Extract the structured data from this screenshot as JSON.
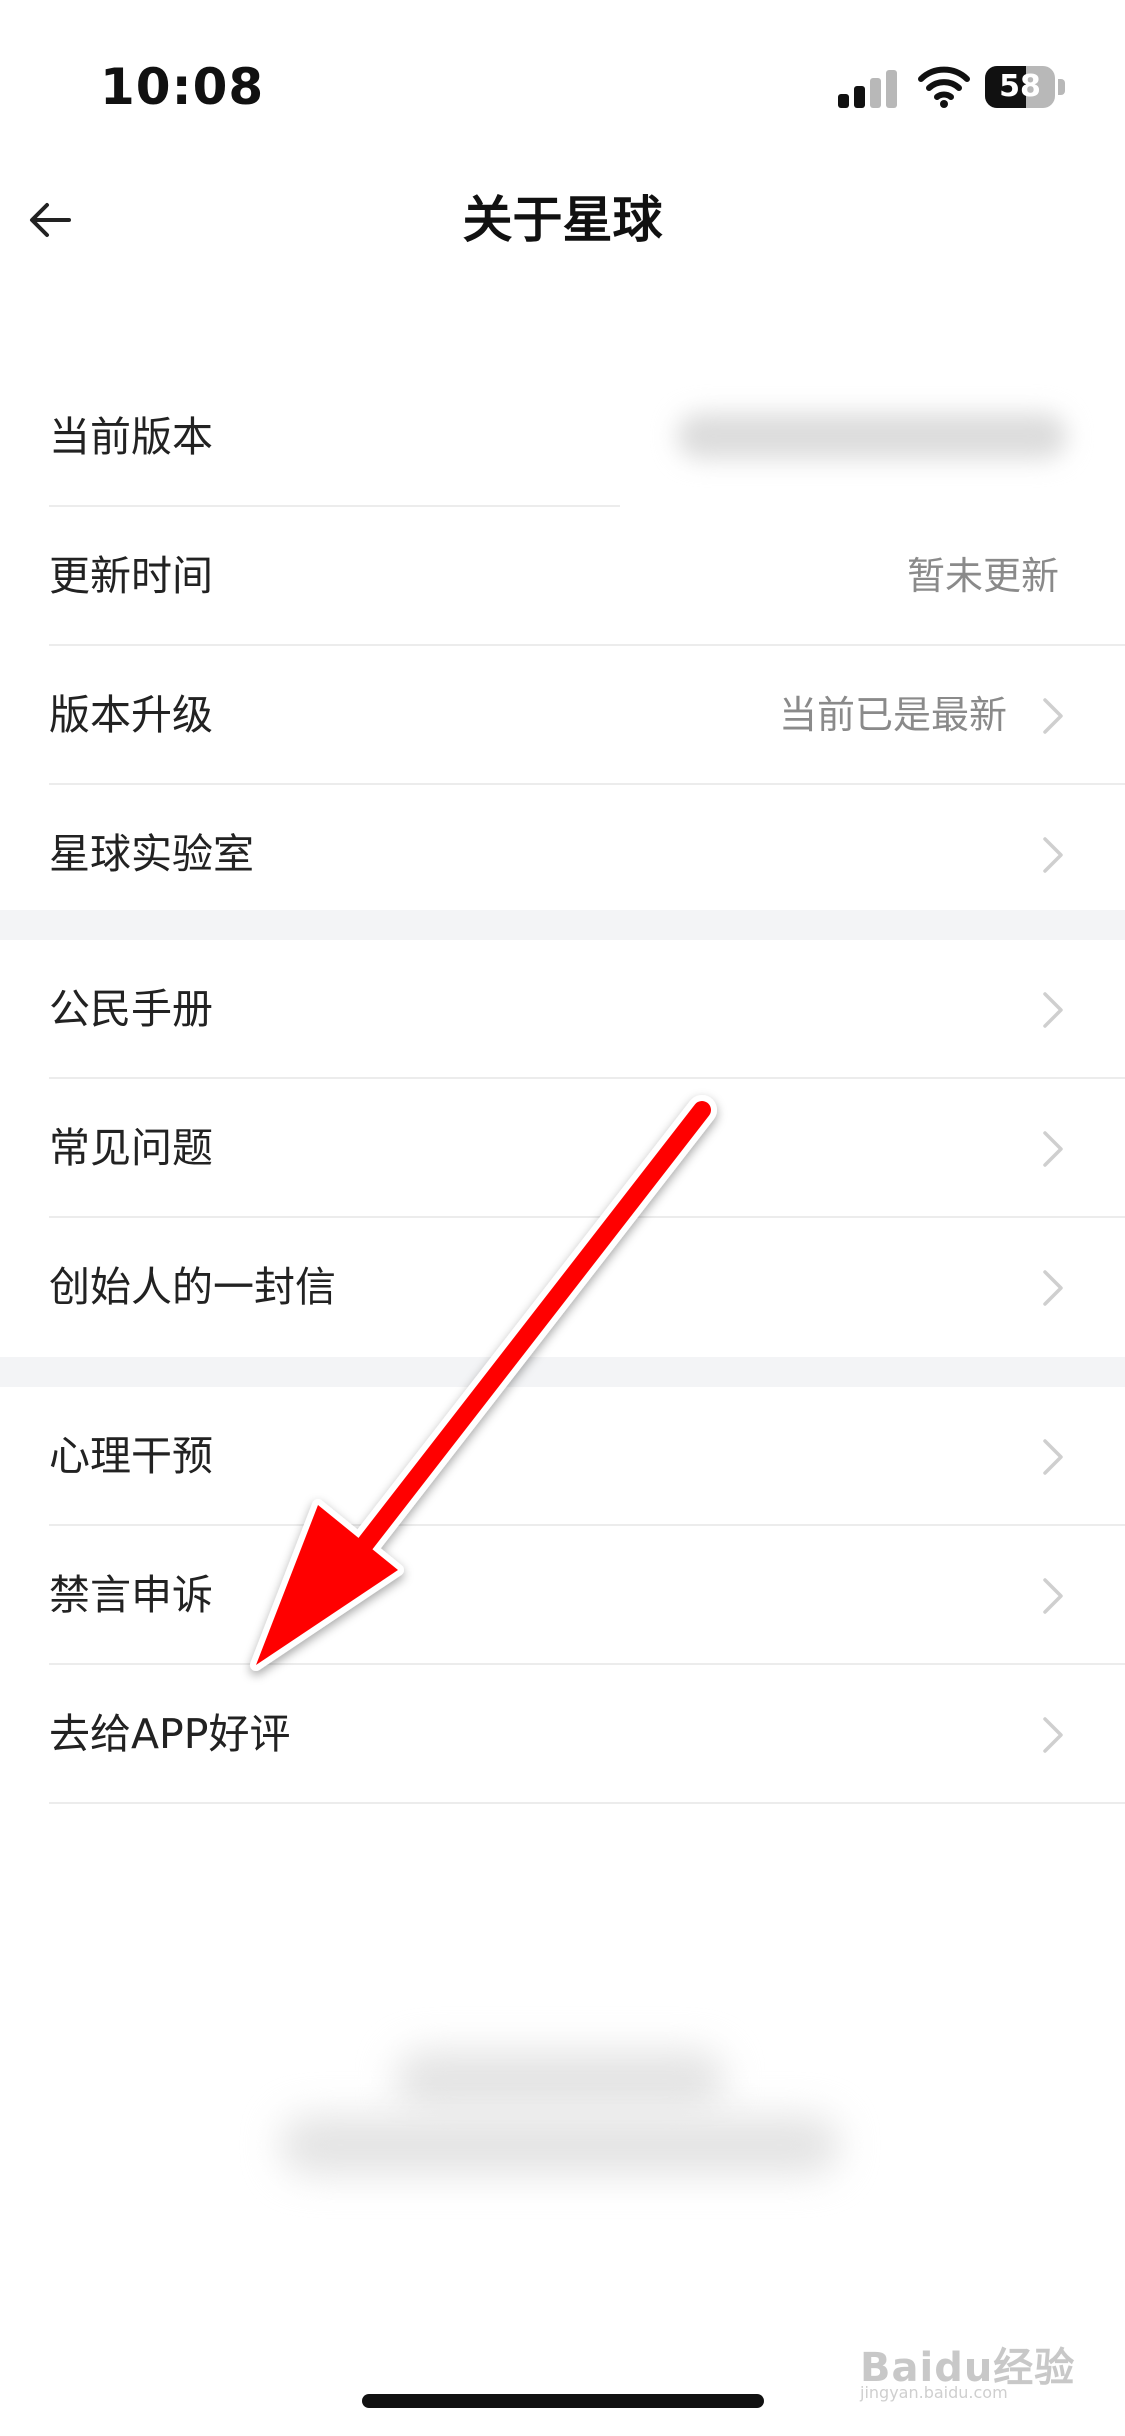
{
  "status_bar": {
    "time": "10:08",
    "battery": "58",
    "battery_level": 0.58
  },
  "header": {
    "title": "关于星球"
  },
  "groups": [
    {
      "rows": [
        {
          "label": "当前版本",
          "value": ""
        },
        {
          "label": "更新时间",
          "value": "暂未更新"
        },
        {
          "label": "版本升级",
          "value": "当前已是最新"
        },
        {
          "label": "星球实验室"
        }
      ]
    },
    {
      "rows": [
        {
          "label": "公民手册"
        },
        {
          "label": "常见问题"
        },
        {
          "label": "创始人的一封信"
        }
      ]
    },
    {
      "rows": [
        {
          "label": "心理干预"
        },
        {
          "label": "禁言申诉"
        },
        {
          "label": "去给APP好评"
        }
      ]
    }
  ],
  "watermark": {
    "text": "Baidu经验",
    "sub": "jingyan.baidu.com"
  },
  "colors": {
    "annotation_arrow": "#ff0000",
    "group_gap": "#f3f4f6",
    "secondary_text": "#8a8a8a"
  },
  "icons": [
    "back-arrow-icon",
    "chevron-right-icon",
    "cellular-signal-icon",
    "wifi-icon",
    "battery-icon"
  ]
}
